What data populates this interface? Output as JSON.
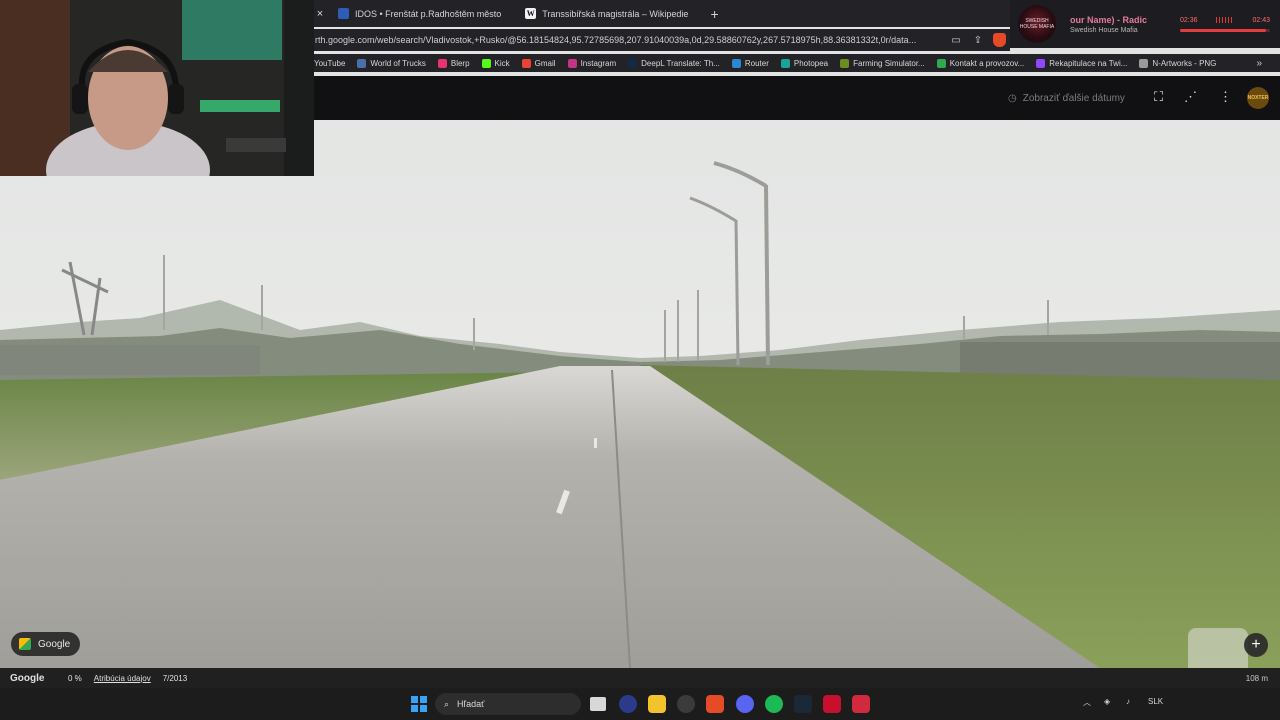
{
  "browser": {
    "tabs": [
      {
        "label": "IDOS • Frenštát p.Radhoštěm město",
        "icon": "idos-favicon"
      },
      {
        "label": "Transsibiřská magistrála – Wikipedie",
        "icon": "wikipedia-favicon"
      }
    ],
    "new_tab": "+",
    "close_tab": "×",
    "url": "rth.google.com/web/search/Vladivostok,+Rusko/@56.18154824,95.72785698,207.91040039a,0d,29.58860762y,267.5718975h,88.36381332t,0r/data...",
    "bookmarks": [
      {
        "label": "YouTube",
        "color": "#ff0000"
      },
      {
        "label": "World of Trucks",
        "color": "#4b6fa8"
      },
      {
        "label": "Blerp",
        "color": "#e8336d"
      },
      {
        "label": "Kick",
        "color": "#53fc18"
      },
      {
        "label": "Gmail",
        "color": "#ea4335"
      },
      {
        "label": "Instagram",
        "color": "#c13584"
      },
      {
        "label": "DeepL Translate: Th...",
        "color": "#0f2b46"
      },
      {
        "label": "Router",
        "color": "#2b87d1"
      },
      {
        "label": "Photopea",
        "color": "#18a497"
      },
      {
        "label": "Farming Simulator...",
        "color": "#6b8e23"
      },
      {
        "label": "Kontakt a provozov...",
        "color": "#2fa84f"
      },
      {
        "label": "Rekapitulace na Twi...",
        "color": "#9146ff"
      },
      {
        "label": "N-Artworks - PNG",
        "color": "#9a9a9a"
      }
    ],
    "bookmarks_more": "»"
  },
  "media": {
    "title": "our Name) - Radic",
    "artist": "Swedish House Mafia",
    "album_text": "SWEDISH HOUSE MAFIA",
    "elapsed": "02:36",
    "duration": "02:43",
    "progress": 0.95
  },
  "streetview": {
    "show_dates": "Zobraziť ďalšie dátumy",
    "avatar_text": "NOXTER",
    "chip_label": "Google",
    "zoom_in": "+"
  },
  "footer": {
    "logo": "Google",
    "zoom": "0 %",
    "attribution": "Atribúcia údajov",
    "date": "7/2013",
    "right": "108 m"
  },
  "taskbar": {
    "search_placeholder": "Hľadať",
    "lang": "SLK"
  },
  "colors": {
    "sky": "#e9ebea",
    "road": "#a8a7a2",
    "grass": "#7f9a50"
  }
}
